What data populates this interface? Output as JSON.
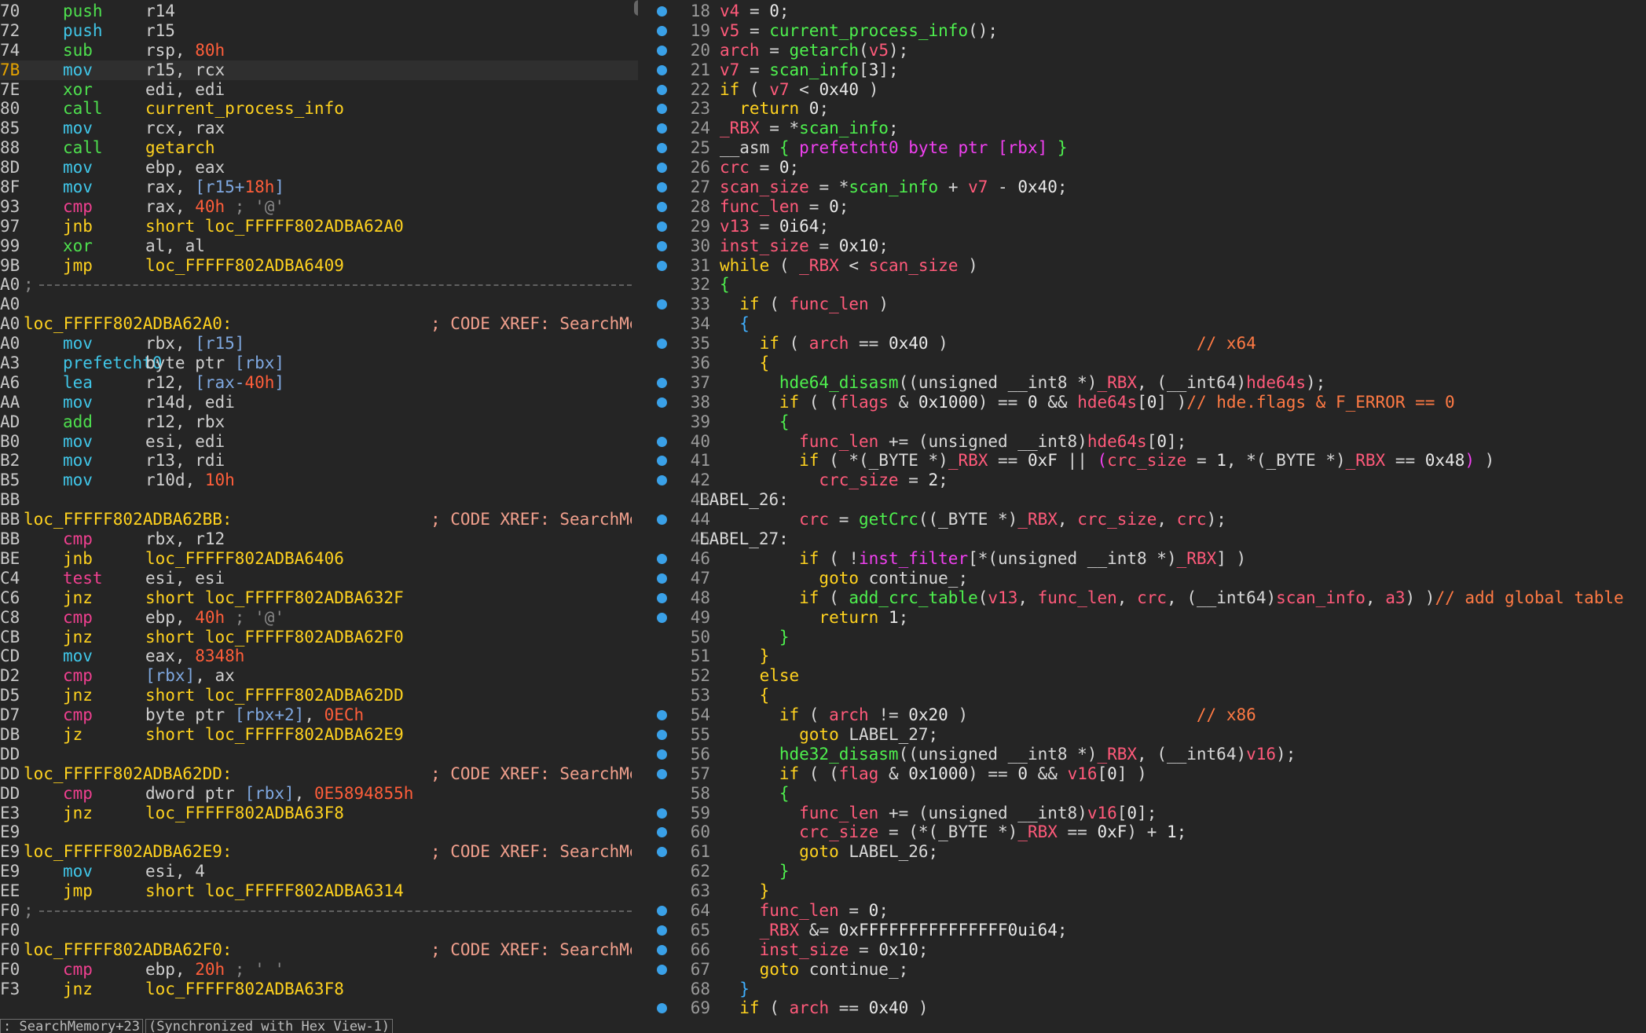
{
  "disasm": {
    "lines": [
      {
        "addr": "70",
        "mn": "push",
        "op": "r14",
        "mn_color": "c-green"
      },
      {
        "addr": "72",
        "mn": "push",
        "op": "r15",
        "mn_color": "c-cyan"
      },
      {
        "addr": "74",
        "mn": "sub",
        "op": "rsp, 80h",
        "mn_color": "c-green"
      },
      {
        "addr": "7B",
        "mn": "mov",
        "op": "r15, rcx",
        "mn_color": "c-cyan",
        "highlight": true
      },
      {
        "addr": "7E",
        "mn": "xor",
        "op": "edi, edi",
        "mn_color": "c-green"
      },
      {
        "addr": "80",
        "mn": "call",
        "op": "current_process_info",
        "mn_color": "c-green",
        "op_color": "c-yellow"
      },
      {
        "addr": "85",
        "mn": "mov",
        "op": "rcx, rax",
        "mn_color": "c-cyan"
      },
      {
        "addr": "88",
        "mn": "call",
        "op": "getarch",
        "mn_color": "c-green",
        "op_color": "c-yellow"
      },
      {
        "addr": "8D",
        "mn": "mov",
        "op": "ebp, eax",
        "mn_color": "c-cyan"
      },
      {
        "addr": "8F",
        "mn": "mov",
        "op": "rax, [r15+18h]",
        "mn_color": "c-cyan"
      },
      {
        "addr": "93",
        "mn": "cmp",
        "op": "rax, 40h ; '@'",
        "mn_color": "c-pink"
      },
      {
        "addr": "97",
        "mn": "jnb",
        "op": "short loc_FFFFF802ADBA62A0",
        "mn_color": "c-yellow",
        "op_color": "c-yellow"
      },
      {
        "addr": "99",
        "mn": "xor",
        "op": "al, al",
        "mn_color": "c-green"
      },
      {
        "addr": "9B",
        "mn": "jmp",
        "op": "loc_FFFFF802ADBA6409",
        "mn_color": "c-yellow",
        "op_color": "c-yellow"
      },
      {
        "addr": "A0",
        "sep": true,
        "prefix": ";"
      },
      {
        "addr": "A0"
      },
      {
        "addr": "A0",
        "label": "loc_FFFFF802ADBA62A0:",
        "xref": "; CODE XREF: SearchMemory"
      },
      {
        "addr": "A0",
        "mn": "mov",
        "op": "rbx, [r15]",
        "mn_color": "c-cyan"
      },
      {
        "addr": "A3",
        "mn": "prefetcht0",
        "op": "byte ptr [rbx]",
        "mn_color": "c-cyan"
      },
      {
        "addr": "A6",
        "mn": "lea",
        "op": "r12, [rax-40h]",
        "mn_color": "c-cyan"
      },
      {
        "addr": "AA",
        "mn": "mov",
        "op": "r14d, edi",
        "mn_color": "c-cyan"
      },
      {
        "addr": "AD",
        "mn": "add",
        "op": "r12, rbx",
        "mn_color": "c-green"
      },
      {
        "addr": "B0",
        "mn": "mov",
        "op": "esi, edi",
        "mn_color": "c-cyan"
      },
      {
        "addr": "B2",
        "mn": "mov",
        "op": "r13, rdi",
        "mn_color": "c-cyan"
      },
      {
        "addr": "B5",
        "mn": "mov",
        "op": "r10d, 10h",
        "mn_color": "c-cyan"
      },
      {
        "addr": "BB"
      },
      {
        "addr": "BB",
        "label": "loc_FFFFF802ADBA62BB:",
        "xref": "; CODE XREF: SearchMemory"
      },
      {
        "addr": "BB",
        "mn": "cmp",
        "op": "rbx, r12",
        "mn_color": "c-pink"
      },
      {
        "addr": "BE",
        "mn": "jnb",
        "op": "loc_FFFFF802ADBA6406",
        "mn_color": "c-yellow",
        "op_color": "c-yellow"
      },
      {
        "addr": "C4",
        "mn": "test",
        "op": "esi, esi",
        "mn_color": "c-pink"
      },
      {
        "addr": "C6",
        "mn": "jnz",
        "op": "short loc_FFFFF802ADBA632F",
        "mn_color": "c-yellow",
        "op_color": "c-yellow"
      },
      {
        "addr": "C8",
        "mn": "cmp",
        "op": "ebp, 40h ; '@'",
        "mn_color": "c-pink"
      },
      {
        "addr": "CB",
        "mn": "jnz",
        "op": "short loc_FFFFF802ADBA62F0",
        "mn_color": "c-yellow",
        "op_color": "c-yellow"
      },
      {
        "addr": "CD",
        "mn": "mov",
        "op": "eax, 8348h",
        "mn_color": "c-cyan"
      },
      {
        "addr": "D2",
        "mn": "cmp",
        "op": "[rbx], ax",
        "mn_color": "c-pink"
      },
      {
        "addr": "D5",
        "mn": "jnz",
        "op": "short loc_FFFFF802ADBA62DD",
        "mn_color": "c-yellow",
        "op_color": "c-yellow"
      },
      {
        "addr": "D7",
        "mn": "cmp",
        "op": "byte ptr [rbx+2], 0ECh",
        "mn_color": "c-pink"
      },
      {
        "addr": "DB",
        "mn": "jz",
        "op": "short loc_FFFFF802ADBA62E9",
        "mn_color": "c-yellow",
        "op_color": "c-yellow"
      },
      {
        "addr": "DD"
      },
      {
        "addr": "DD",
        "label": "loc_FFFFF802ADBA62DD:",
        "xref": "; CODE XREF: SearchMemory"
      },
      {
        "addr": "DD",
        "mn": "cmp",
        "op": "dword ptr [rbx], 0E5894855h",
        "mn_color": "c-pink"
      },
      {
        "addr": "E3",
        "mn": "jnz",
        "op": "loc_FFFFF802ADBA63F8",
        "mn_color": "c-yellow",
        "op_color": "c-yellow"
      },
      {
        "addr": "E9"
      },
      {
        "addr": "E9",
        "label": "loc_FFFFF802ADBA62E9:",
        "xref": "; CODE XREF: SearchMemory"
      },
      {
        "addr": "E9",
        "mn": "mov",
        "op": "esi, 4",
        "mn_color": "c-cyan"
      },
      {
        "addr": "EE",
        "mn": "jmp",
        "op": "short loc_FFFFF802ADBA6314",
        "mn_color": "c-yellow",
        "op_color": "c-yellow"
      },
      {
        "addr": "F0",
        "sep": true,
        "prefix": ";"
      },
      {
        "addr": "F0"
      },
      {
        "addr": "F0",
        "label": "loc_FFFFF802ADBA62F0:",
        "xref": "; CODE XREF: SearchMemory"
      },
      {
        "addr": "F0",
        "mn": "cmp",
        "op": "ebp, 20h ; ' '",
        "mn_color": "c-pink"
      },
      {
        "addr": "F3",
        "mn": "jnz",
        "op": "loc_FFFFF802ADBA63F8",
        "mn_color": "c-yellow",
        "op_color": "c-yellow"
      }
    ]
  },
  "status": {
    "location": ": SearchMemory+23",
    "sync": "(Synchronized with Hex View-1)"
  },
  "pseudocode": {
    "lines": [
      {
        "n": "18",
        "bp": true,
        "html": "<span class='v'>v4</span><span class='o'> = </span><span class='n'>0</span><span class='o'>;</span>"
      },
      {
        "n": "19",
        "bp": true,
        "html": "<span class='v'>v5</span><span class='o'> = </span><span class='f'>current_process_info</span><span class='o'>();</span>"
      },
      {
        "n": "20",
        "bp": true,
        "html": "<span class='v'>arch</span><span class='o'> = </span><span class='f'>getarch</span><span class='o'>(</span><span class='v'>v5</span><span class='o'>);</span>"
      },
      {
        "n": "21",
        "bp": true,
        "html": "<span class='v'>v7</span><span class='o'> = </span><span class='f'>scan_info</span><span class='o'>[</span><span class='n'>3</span><span class='o'>];</span>"
      },
      {
        "n": "22",
        "bp": true,
        "html": "<span class='k'>if</span><span class='o'> ( </span><span class='v'>v7</span><span class='o'> &lt; </span><span class='n'>0x40</span><span class='o'> )</span>"
      },
      {
        "n": "23",
        "bp": true,
        "html": "<span class='k'>  return </span><span class='n'>0</span><span class='o'>;</span>"
      },
      {
        "n": "24",
        "bp": true,
        "html": "<span class='v'>_RBX</span><span class='o'> = *</span><span class='f'>scan_info</span><span class='o'>;</span>"
      },
      {
        "n": "25",
        "bp": true,
        "html": "<span class='o'>__asm </span><span class='f'>{</span><span class='pu'> prefetcht0 byte ptr [rbx] </span><span class='f'>}</span>"
      },
      {
        "n": "26",
        "bp": true,
        "html": "<span class='v'>crc</span><span class='o'> = </span><span class='n'>0</span><span class='o'>;</span>"
      },
      {
        "n": "27",
        "bp": true,
        "html": "<span class='v'>scan_size</span><span class='o'> = *</span><span class='f'>scan_info</span><span class='o'> + </span><span class='v'>v7</span><span class='o'> - </span><span class='n'>0x40</span><span class='o'>;</span>"
      },
      {
        "n": "28",
        "bp": true,
        "html": "<span class='v'>func_len</span><span class='o'> = </span><span class='n'>0</span><span class='o'>;</span>"
      },
      {
        "n": "29",
        "bp": true,
        "html": "<span class='v'>v13</span><span class='o'> = </span><span class='n'>0i64</span><span class='o'>;</span>"
      },
      {
        "n": "30",
        "bp": true,
        "html": "<span class='v'>inst_size</span><span class='o'> = </span><span class='n'>0x10</span><span class='o'>;</span>"
      },
      {
        "n": "31",
        "bp": true,
        "html": "<span class='k'>while</span><span class='o'> ( </span><span class='v'>_RBX</span><span class='o'> &lt; </span><span class='v'>scan_size</span><span class='o'> )</span>"
      },
      {
        "n": "32",
        "bp": false,
        "html": "<span class='f'>{</span>"
      },
      {
        "n": "33",
        "bp": true,
        "html": "<span class='k'>  if</span><span class='o'> ( </span><span class='v'>func_len</span><span class='o'> )</span>"
      },
      {
        "n": "34",
        "bp": false,
        "html": "<span class='bl'>  {</span>"
      },
      {
        "n": "35",
        "bp": true,
        "html": "<span class='k'>    if</span><span class='o'> ( </span><span class='v'>arch</span><span class='o'> == </span><span class='n'>0x40</span><span class='o'> )                         </span><span class='cm'>// x64</span>"
      },
      {
        "n": "36",
        "bp": false,
        "html": "<span class='k'>    {</span>"
      },
      {
        "n": "37",
        "bp": true,
        "html": "<span class='f'>      hde64_disasm</span><span class='o'>((unsigned __int8 *)</span><span class='v'>_RBX</span><span class='o'>, (__int64)</span><span class='v'>hde64s</span><span class='o'>);</span>"
      },
      {
        "n": "38",
        "bp": true,
        "html": "<span class='k'>      if</span><span class='o'> ( (</span><span class='v'>flags</span><span class='o'> &amp; </span><span class='n'>0x1000</span><span class='o'>) == </span><span class='n'>0</span><span class='o'> &amp;&amp; </span><span class='v'>hde64s</span><span class='o'>[</span><span class='n'>0</span><span class='o'>] )</span><span class='cm'>// hde.flags &amp; F_ERROR == 0</span>"
      },
      {
        "n": "39",
        "bp": false,
        "html": "<span class='f'>      {</span>"
      },
      {
        "n": "40",
        "bp": true,
        "html": "<span class='v'>        func_len</span><span class='o'> += (unsigned __int8)</span><span class='v'>hde64s</span><span class='o'>[</span><span class='n'>0</span><span class='o'>];</span>"
      },
      {
        "n": "41",
        "bp": true,
        "html": "<span class='k'>        if</span><span class='o'> ( *(_BYTE *)</span><span class='v'>_RBX</span><span class='o'> == </span><span class='n'>0xF</span><span class='o'> || </span><span class='pu'>(</span><span class='v'>crc_size</span><span class='o'> = </span><span class='n'>1</span><span class='o'>, *(_BYTE *)</span><span class='v'>_RBX</span><span class='o'> == </span><span class='n'>0x48</span><span class='pu'>)</span><span class='o'> )</span>"
      },
      {
        "n": "42",
        "bp": true,
        "html": "<span class='v'>          crc_size</span><span class='o'> = </span><span class='n'>2</span><span class='o'>;</span>"
      },
      {
        "n": "43",
        "bp": false,
        "label": true,
        "html": "<span class='o'>LABEL_26:</span>"
      },
      {
        "n": "44",
        "bp": true,
        "html": "<span class='v'>        crc</span><span class='o'> = </span><span class='f'>getCrc</span><span class='o'>((_BYTE *)</span><span class='v'>_RBX</span><span class='o'>, </span><span class='v'>crc_size</span><span class='o'>, </span><span class='v'>crc</span><span class='o'>);</span>"
      },
      {
        "n": "45",
        "bp": false,
        "label": true,
        "html": "<span class='o'>LABEL_27:</span>"
      },
      {
        "n": "46",
        "bp": true,
        "html": "<span class='k'>        if</span><span class='o'> ( !</span><span class='pu'>inst_filter</span><span class='o'>[*(unsigned __int8 *)</span><span class='v'>_RBX</span><span class='o'>] )</span>"
      },
      {
        "n": "47",
        "bp": true,
        "html": "<span class='k'>          goto </span><span class='o'>continue_;</span>"
      },
      {
        "n": "48",
        "bp": true,
        "html": "<span class='k'>        if</span><span class='o'> ( </span><span class='f'>add_crc_table</span><span class='o'>(</span><span class='v'>v13</span><span class='o'>, </span><span class='v'>func_len</span><span class='o'>, </span><span class='v'>crc</span><span class='o'>, (__int64)</span><span class='v'>scan_info</span><span class='o'>, </span><span class='v'>a3</span><span class='o'>) )</span><span class='cm'>// add global table</span>"
      },
      {
        "n": "49",
        "bp": true,
        "html": "<span class='k'>          return </span><span class='n'>1</span><span class='o'>;</span>"
      },
      {
        "n": "50",
        "bp": false,
        "html": "<span class='f'>      }</span>"
      },
      {
        "n": "51",
        "bp": false,
        "html": "<span class='k'>    }</span>"
      },
      {
        "n": "52",
        "bp": false,
        "html": "<span class='k'>    else</span>"
      },
      {
        "n": "53",
        "bp": false,
        "html": "<span class='k'>    {</span>"
      },
      {
        "n": "54",
        "bp": true,
        "html": "<span class='k'>      if</span><span class='o'> ( </span><span class='v'>arch</span><span class='o'> != </span><span class='n'>0x20</span><span class='o'> )                       </span><span class='cm'>// x86</span>"
      },
      {
        "n": "55",
        "bp": true,
        "html": "<span class='k'>        goto </span><span class='o'>LABEL_27;</span>"
      },
      {
        "n": "56",
        "bp": true,
        "html": "<span class='f'>      hde32_disasm</span><span class='o'>((unsigned __int8 *)</span><span class='v'>_RBX</span><span class='o'>, (__int64)</span><span class='v'>v16</span><span class='o'>);</span>"
      },
      {
        "n": "57",
        "bp": true,
        "html": "<span class='k'>      if</span><span class='o'> ( (</span><span class='v'>flag</span><span class='o'> &amp; </span><span class='n'>0x1000</span><span class='o'>) == </span><span class='n'>0</span><span class='o'> &amp;&amp; </span><span class='v'>v16</span><span class='o'>[</span><span class='n'>0</span><span class='o'>] )</span>"
      },
      {
        "n": "58",
        "bp": false,
        "html": "<span class='f'>      {</span>"
      },
      {
        "n": "59",
        "bp": true,
        "html": "<span class='v'>        func_len</span><span class='o'> += (unsigned __int8)</span><span class='v'>v16</span><span class='o'>[</span><span class='n'>0</span><span class='o'>];</span>"
      },
      {
        "n": "60",
        "bp": true,
        "html": "<span class='v'>        crc_size</span><span class='o'> = (*(_BYTE *)</span><span class='v'>_RBX</span><span class='o'> == </span><span class='n'>0xF</span><span class='o'>) + </span><span class='n'>1</span><span class='o'>;</span>"
      },
      {
        "n": "61",
        "bp": true,
        "html": "<span class='k'>        goto </span><span class='o'>LABEL_26;</span>"
      },
      {
        "n": "62",
        "bp": false,
        "html": "<span class='f'>      }</span>"
      },
      {
        "n": "63",
        "bp": false,
        "html": "<span class='k'>    }</span>"
      },
      {
        "n": "64",
        "bp": true,
        "html": "<span class='v'>    func_len</span><span class='o'> = </span><span class='n'>0</span><span class='o'>;</span>"
      },
      {
        "n": "65",
        "bp": true,
        "html": "<span class='v'>    _RBX</span><span class='o'> &amp;= </span><span class='n'>0xFFFFFFFFFFFFFFF0ui64</span><span class='o'>;</span>"
      },
      {
        "n": "66",
        "bp": true,
        "html": "<span class='v'>    inst_size</span><span class='o'> = </span><span class='n'>0x10</span><span class='o'>;</span>"
      },
      {
        "n": "67",
        "bp": true,
        "html": "<span class='k'>    goto </span><span class='o'>continue_;</span>"
      },
      {
        "n": "68",
        "bp": false,
        "html": "<span class='bl'>  }</span>"
      },
      {
        "n": "69",
        "bp": true,
        "html": "<span class='k'>  if</span><span class='o'> ( </span><span class='v'>arch</span><span class='o'> == </span><span class='n'>0x40</span><span class='o'> )</span>"
      }
    ]
  }
}
